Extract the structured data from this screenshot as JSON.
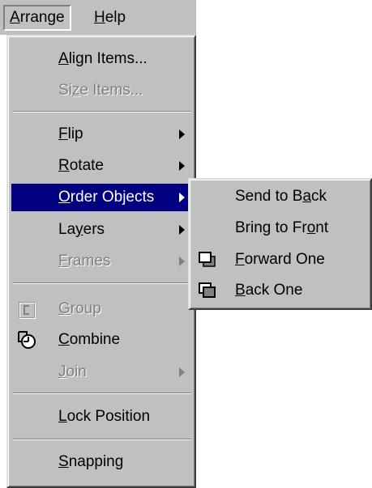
{
  "menubar": {
    "arrange": {
      "u": "A",
      "rest": "rrange"
    },
    "help": {
      "u": "H",
      "rest": "elp"
    }
  },
  "menu": {
    "align_items": {
      "u": "A",
      "rest": "lign Items..."
    },
    "size_items": {
      "pre": "Si",
      "u": "z",
      "rest": "e Items..."
    },
    "flip": {
      "u": "F",
      "rest": "lip"
    },
    "rotate": {
      "u": "R",
      "rest": "otate"
    },
    "order_objects": {
      "u": "O",
      "rest": "rder Objects"
    },
    "layers": {
      "pre": "La",
      "u": "y",
      "rest": "ers"
    },
    "frames": {
      "u": "F",
      "rest": "rames"
    },
    "group": {
      "u": "G",
      "rest": "roup"
    },
    "combine": {
      "u": "C",
      "rest": "ombine"
    },
    "join": {
      "u": "J",
      "rest": "oin"
    },
    "lock_position": {
      "u": "L",
      "rest": "ock Position"
    },
    "snapping": {
      "u": "S",
      "rest": "napping"
    }
  },
  "submenu": {
    "send_to_back": {
      "pre": "Send to B",
      "u": "a",
      "rest": "ck"
    },
    "bring_to_front": {
      "pre": "Bring to Fr",
      "u": "o",
      "rest": "nt"
    },
    "forward_one": {
      "u": "F",
      "rest": "orward One"
    },
    "back_one": {
      "u": "B",
      "rest": "ack One"
    }
  },
  "icons": {
    "group": "group-icon",
    "combine": "combine-icon",
    "forward_one": "forward-one-icon",
    "back_one": "back-one-icon"
  }
}
